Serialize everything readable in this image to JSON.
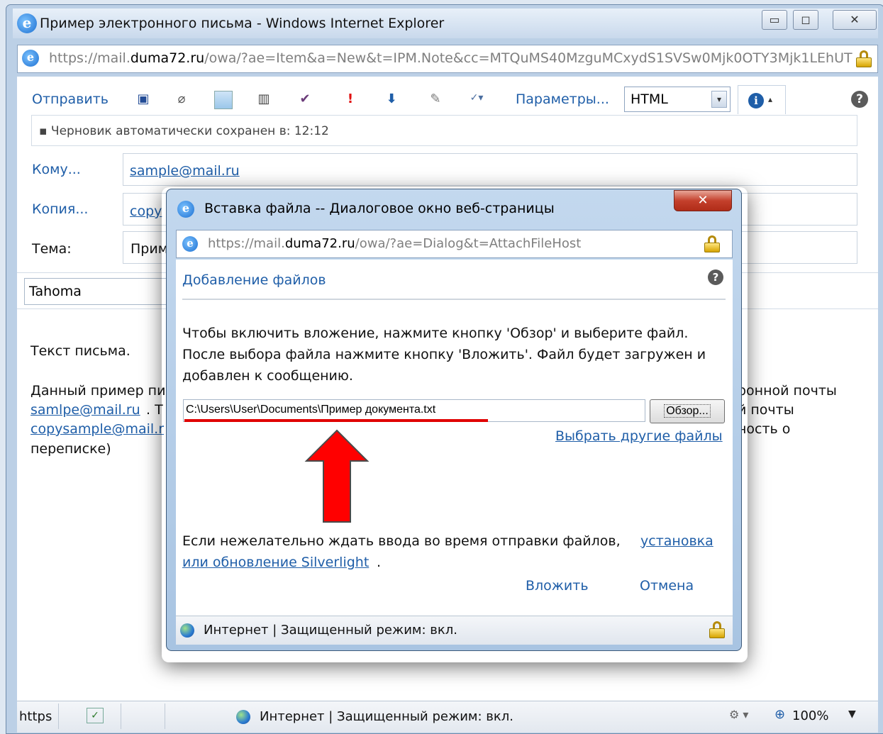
{
  "window": {
    "title": "Пример электронного письма - Windows Internet Explorer",
    "url_prefix": "https://mail.",
    "url_domain": "duma72.ru",
    "url_path": "/owa/?ae=Item&a=New&t=IPM.Note&cc=MTQuMS40MzguMCxydS1SVSw0Mjk0OTY3Mjk1LEhUT"
  },
  "toolbar": {
    "send_label": "Отправить",
    "options_label": "Параметры...",
    "format_value": "HTML"
  },
  "draft_notice": "▪ Черновик автоматически сохранен в: 12:12",
  "fields": {
    "to_label": "Кому...",
    "to_value": "sample@mail.ru",
    "cc_label": "Копия...",
    "cc_value": "copy",
    "subject_label": "Тема:",
    "subject_value": "Прим"
  },
  "format_bar": {
    "font": "Tahoma"
  },
  "body": {
    "line1": "Текст письма.",
    "line2_left": "Данный пример пи",
    "line2_right": "ронной почты",
    "line3_link": "samlpe@mail.ru",
    "line3_after": ". Т",
    "line3_right": "й почты",
    "line4_link": "copysample@mail.r",
    "line4_right": "ность о",
    "line5": "переписке)"
  },
  "status": {
    "left": "https",
    "zone": "Интернет | Защищенный режим: вкл.",
    "zoom": "100%"
  },
  "dialog": {
    "title": "Вставка файла -- Диалоговое окно веб-страницы",
    "url_prefix": "https://mail.",
    "url_domain": "duma72.ru",
    "url_path": "/owa/?ae=Dialog&t=AttachFileHost",
    "heading": "Добавление файлов",
    "instructions": [
      "Чтобы включить вложение, нажмите кнопку 'Обзор' и выберите файл.",
      "После выбора файла нажмите кнопку 'Вложить'. Файл будет загружен и",
      "добавлен к сообщению."
    ],
    "file_path": "C:\\Users\\User\\Documents\\Пример документа.txt",
    "browse_label": "Обзор...",
    "other_files_link": "Выбрать другие файлы",
    "silverlight_text": "Если нежелательно ждать ввода во время отправки файлов,",
    "silverlight_link1": "установка",
    "silverlight_link2": "или обновление Silverlight",
    "silverlight_end": ".",
    "attach_label": "Вложить",
    "cancel_label": "Отмена",
    "status_text": "Интернет | Защищенный режим: вкл."
  },
  "colors": {
    "link": "#1f5ea8",
    "arrow": "#ff0000",
    "underline": "#e00000"
  }
}
